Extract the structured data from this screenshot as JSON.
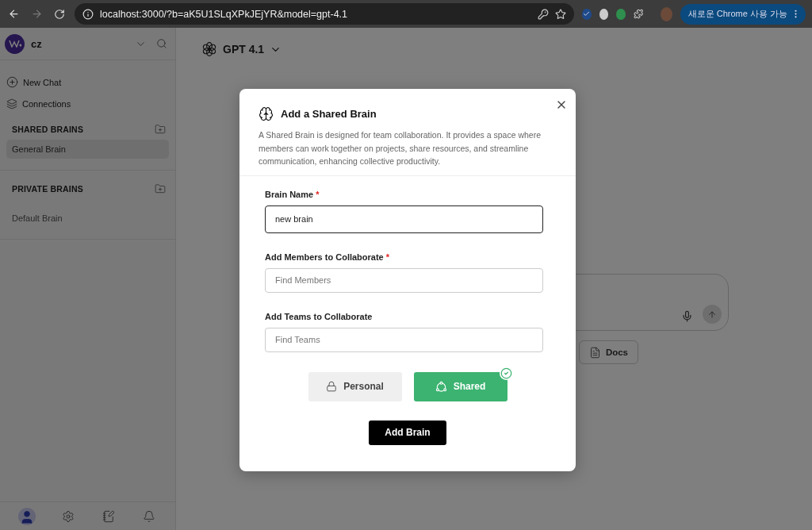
{
  "browser": {
    "url": "localhost:3000/?b=aK5U1SLqXPkJEjYR&model=gpt-4.1",
    "update_button": "새로운 Chrome 사용 가능",
    "forward_disabled": true
  },
  "sidebar": {
    "user": "cz",
    "items": [
      {
        "label": "New Chat",
        "kind": "new"
      },
      {
        "label": "Connections",
        "kind": "connections"
      }
    ],
    "sections": [
      {
        "title": "SHARED BRAINS",
        "items": [
          {
            "label": "General Brain",
            "selected": true
          }
        ]
      },
      {
        "title": "PRIVATE BRAINS",
        "items": [
          {
            "label": "Default Brain",
            "selected": false
          }
        ]
      }
    ]
  },
  "main": {
    "model": "GPT 4.1",
    "docs_button": "Docs"
  },
  "modal": {
    "title": "Add a Shared Brain",
    "description": "A Shared Brain is designed for team collaboration. It provides a space where members can work together on projects, share resources, and streamline communication, enhancing collective productivity.",
    "fields": [
      {
        "label": "Brain Name",
        "required_mark": "*",
        "value": "new brain",
        "focused": true
      },
      {
        "label": "Add Members to Collaborate",
        "required_mark": "*",
        "placeholder": "Find Members",
        "focused": false
      },
      {
        "label": "Add Teams to Collaborate",
        "placeholder": "Find Teams",
        "focused": false
      }
    ],
    "brain_types": [
      {
        "label": "Personal",
        "kind": "personal",
        "selected": false
      },
      {
        "label": "Shared",
        "kind": "shared",
        "selected": true
      }
    ],
    "submit": "Add Brain"
  }
}
